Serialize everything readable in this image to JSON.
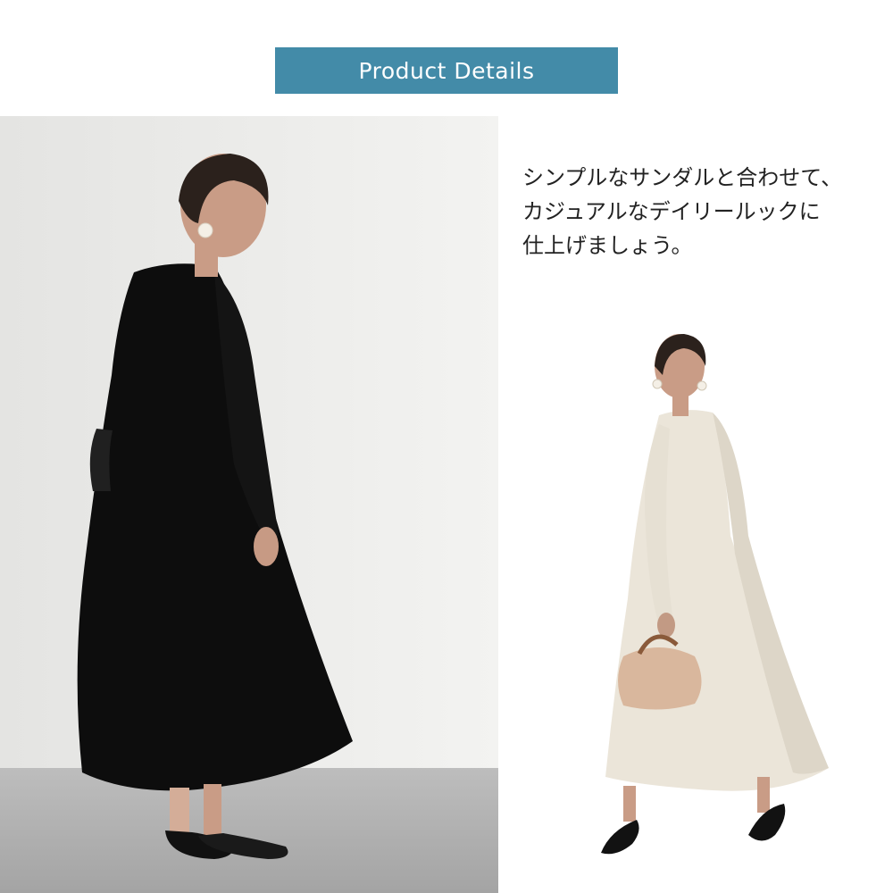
{
  "header": {
    "title": "Product Details",
    "background_color": "#438ba8",
    "text_color": "#ffffff"
  },
  "caption": {
    "lines": [
      "シンプルなサンダルと合わせて、",
      "カジュアルなデイリールックに",
      "仕上げましょう。"
    ]
  },
  "photos": {
    "left": {
      "subject": "model-black-dress-side-view",
      "dress_color": "#0d0d0d"
    },
    "right": {
      "subject": "model-ivory-dress-with-bag",
      "dress_color": "#ebe5d9"
    }
  }
}
